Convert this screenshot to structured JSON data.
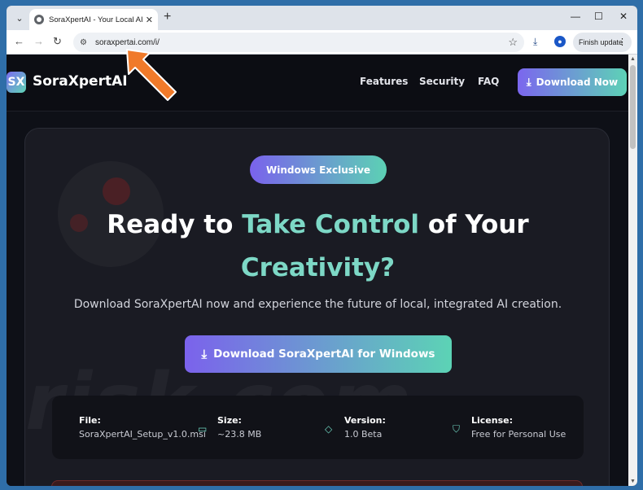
{
  "browser": {
    "tab_title": "SoraXpertAI - Your Local AI Cre",
    "tab_close": "✕",
    "new_tab": "+",
    "url": "soraxpertai.com/i/",
    "finish_update": "Finish update",
    "window_controls": [
      "—",
      "☐",
      "✕"
    ]
  },
  "site": {
    "logo_mark": "SX",
    "logo_text": "SoraXpertAI",
    "nav": [
      "Features",
      "Security",
      "FAQ"
    ],
    "header_cta": "Download Now"
  },
  "hero": {
    "pill": "Windows Exclusive",
    "headline_white": "Ready to ",
    "headline_accent1": "Take Control",
    "headline_white2": " of Your",
    "headline_accent2": "Creativity?",
    "subtext": "Download SoraXpertAI now and experience the future of local, integrated AI creation.",
    "cta": "Download SoraXpertAI for Windows"
  },
  "file_info": {
    "file_label": "File:",
    "file_value": "SoraXpertAI_Setup_v1.0.msi",
    "size_label": "Size:",
    "size_value": "~23.8 MB",
    "version_label": "Version:",
    "version_value": "1.0 Beta",
    "license_label": "License:",
    "license_value": "Free for Personal Use"
  },
  "watermark": "risk.com"
}
